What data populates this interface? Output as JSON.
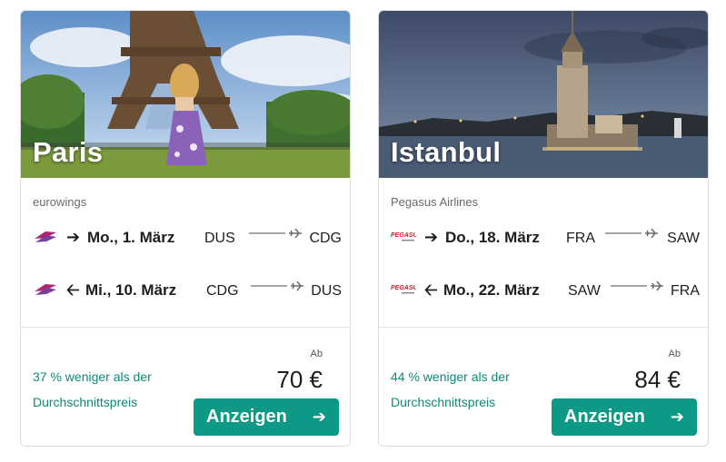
{
  "cards": [
    {
      "city": "Paris",
      "airline": "eurowings",
      "outbound": {
        "direction_icon": "arrow-right-icon",
        "date": "Mo., 1. März",
        "from": "DUS",
        "to": "CDG"
      },
      "return": {
        "direction_icon": "arrow-left-icon",
        "date": "Mi., 10. März",
        "from": "CDG",
        "to": "DUS"
      },
      "deal": "37 % weniger als der Durchschnittspreis",
      "price_prefix": "Ab",
      "price": "70 €",
      "button_label": "Anzeigen",
      "logo_icon": "eurowings-logo-icon"
    },
    {
      "city": "Istanbul",
      "airline": "Pegasus Airlines",
      "outbound": {
        "direction_icon": "arrow-right-icon",
        "date": "Do., 18. März",
        "from": "FRA",
        "to": "SAW"
      },
      "return": {
        "direction_icon": "arrow-left-icon",
        "date": "Mo., 22. März",
        "from": "SAW",
        "to": "FRA"
      },
      "deal": "44 % weniger als der Durchschnittspreis",
      "price_prefix": "Ab",
      "price": "84 €",
      "button_label": "Anzeigen",
      "logo_icon": "pegasus-logo-icon"
    }
  ],
  "colors": {
    "accent": "#0c9a86",
    "deal_text": "#0b8a78",
    "border": "#dcdcdc"
  },
  "glyphs": {
    "arrow_right": "➔",
    "arrow_left": "⟵",
    "button_arrow": "➔"
  }
}
